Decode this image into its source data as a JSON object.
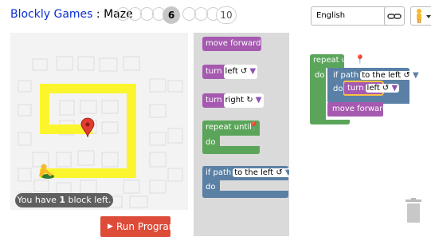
{
  "header": {
    "app_link": "Blockly Games",
    "separator": " : ",
    "game_title": "Maze",
    "current_level": "6",
    "last_level": "10",
    "language": "English"
  },
  "maze": {
    "status_prefix": "You have ",
    "status_count": "1",
    "status_suffix": " block left."
  },
  "run_button": {
    "label": "Run Program"
  },
  "toolbox": {
    "move_forward": "move forward",
    "turn_left_label": "turn",
    "turn_left_value": "left ↺",
    "turn_right_label": "turn",
    "turn_right_value": "right ↻",
    "repeat_until": "repeat until",
    "repeat_do": "do",
    "if_path": "if path",
    "if_path_value": "to the left ↺",
    "if_do": "do"
  },
  "workspace": {
    "repeat_until": "repeat until",
    "repeat_do": "do",
    "if_path": "if path",
    "if_path_value": "to the left ↺",
    "if_do": "do",
    "turn_label": "turn",
    "turn_value": "left ↺",
    "move_forward": "move forward"
  },
  "icons": {
    "dropdown": "chevron-down-icon",
    "link": "link-icon",
    "pegman": "pegman-icon",
    "trash": "trash-icon",
    "goal": "map-marker-icon",
    "play": "play-icon"
  },
  "colors": {
    "link": "#0b2fd4",
    "path": "#fbf52e",
    "motion_block": "#a55ab0",
    "loop_block": "#5ba55b",
    "logic_block": "#5b80a5",
    "run_button": "#dd4b39",
    "toolbox_bg": "#dadada",
    "selection": "#f7c242"
  }
}
